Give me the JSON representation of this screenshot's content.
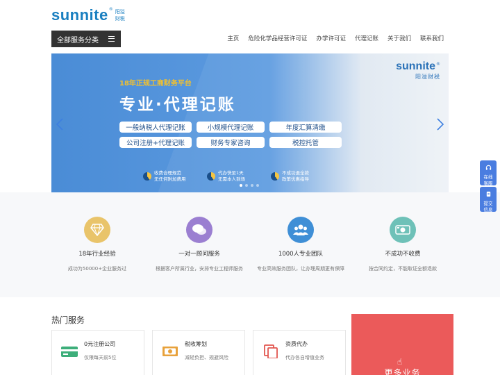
{
  "header": {
    "logo_word": "sunnite",
    "logo_reg": "®",
    "logo_cn_line1": "阳溢",
    "logo_cn_line2": "财税",
    "category_button": "全部服务分类",
    "nav": [
      "主页",
      "危险化学品经营许可证",
      "办学许可证",
      "代理记账",
      "关于我们",
      "联系我们"
    ]
  },
  "banner": {
    "logo_word": "sunnite",
    "logo_reg": "®",
    "logo_cn": "阳溢财税",
    "subtitle": "18年正规工商财务平台",
    "title": "专业·代理记账",
    "pills": [
      "一般纳税人代理记账",
      "小规模代理记账",
      "年度汇算清缴",
      "公司注册+代理记账",
      "财务专家咨询",
      "税控托管"
    ],
    "features": [
      {
        "line1": "收费合理规范",
        "line2": "无任何附加费用"
      },
      {
        "line1": "代办快至1天",
        "line2": "无需本人到场"
      },
      {
        "line1": "不成功退全款",
        "line2": "政策优惠指导"
      }
    ],
    "slide_count": 4,
    "active_slide": 1
  },
  "features": [
    {
      "icon": "diamond-icon",
      "color": "#e9c46a",
      "title": "18年行业经验",
      "desc": "成功为50000+企业服务过"
    },
    {
      "icon": "chat-icon",
      "color": "#9b7fd1",
      "title": "一对一顾问服务",
      "desc": "根据客户所属行业，安排专业工程师服务"
    },
    {
      "icon": "team-icon",
      "color": "#3f8fd6",
      "title": "1000人专业团队",
      "desc": "专业高效服务团队，让办理周期更有保障"
    },
    {
      "icon": "refund-icon",
      "color": "#6ec1b8",
      "title": "不成功不收费",
      "desc": "按合同约定，不能取证全额退款"
    }
  ],
  "hot": {
    "title": "热门服务",
    "cards": [
      {
        "icon": "card-icon",
        "title": "0元注册公司",
        "desc": "仅限每天前5位"
      },
      {
        "icon": "money-icon",
        "title": "税收筹划",
        "desc": "减轻负担、规避风险"
      },
      {
        "icon": "docs-icon",
        "title": "资质代办",
        "desc": "代办各自增值业务"
      }
    ],
    "more_label": "更多业务"
  },
  "side": {
    "online_label": "在线客服",
    "submit_label": "提交信息"
  }
}
